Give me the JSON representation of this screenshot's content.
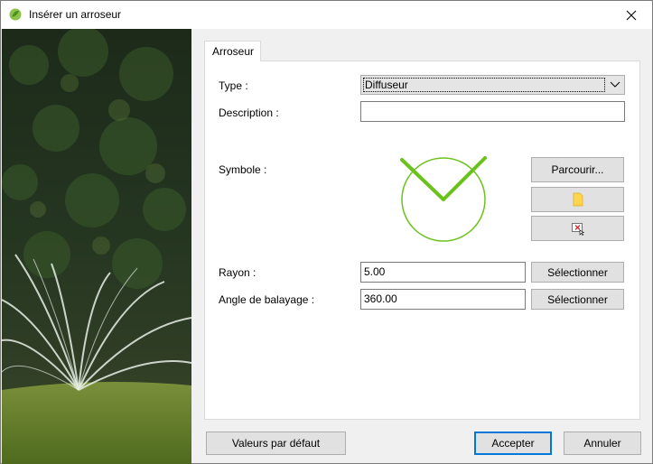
{
  "window": {
    "title": "Insérer un arroseur"
  },
  "tabs": [
    {
      "label": "Arroseur",
      "active": true
    }
  ],
  "form": {
    "type_label": "Type :",
    "type_value": "Diffuseur",
    "description_label": "Description :",
    "description_value": "",
    "symbol_label": "Symbole :",
    "browse_label": "Parcourir...",
    "radius_label": "Rayon :",
    "radius_value": "5.00",
    "radius_select_label": "Sélectionner",
    "angle_label": "Angle de balayage :",
    "angle_value": "360.00",
    "angle_select_label": "Sélectionner"
  },
  "footer": {
    "defaults_label": "Valeurs par défaut",
    "accept_label": "Accepter",
    "cancel_label": "Annuler"
  },
  "colors": {
    "symbol_green": "#6cc21c",
    "accent_blue": "#0078d7"
  }
}
